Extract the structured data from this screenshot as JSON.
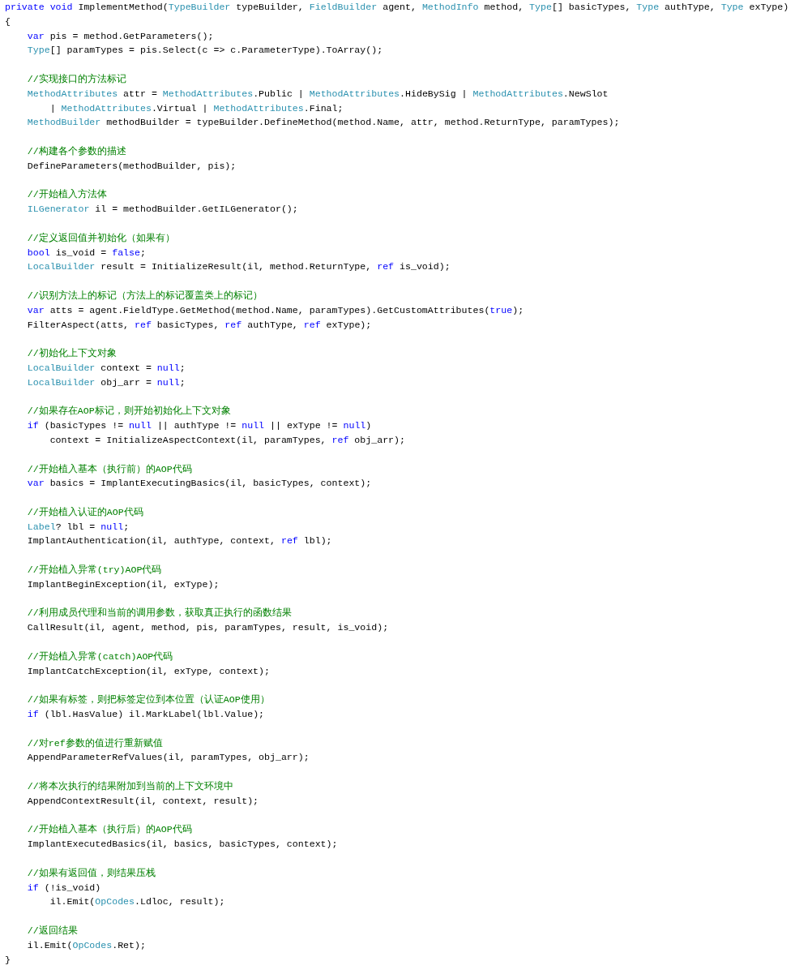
{
  "code_lines": [
    {
      "kind": "code",
      "tokens": [
        {
          "kind": "keyword",
          "text": "private void"
        },
        {
          "kind": "plain",
          "text": " ImplementMethod("
        },
        {
          "kind": "type",
          "text": "TypeBuilder"
        },
        {
          "kind": "plain",
          "text": " typeBuilder, "
        },
        {
          "kind": "type",
          "text": "FieldBuilder"
        },
        {
          "kind": "plain",
          "text": " agent, "
        },
        {
          "kind": "type",
          "text": "MethodInfo"
        },
        {
          "kind": "plain",
          "text": " method, "
        },
        {
          "kind": "type",
          "text": "Type"
        },
        {
          "kind": "plain",
          "text": "[] basicTypes, "
        },
        {
          "kind": "type",
          "text": "Type"
        },
        {
          "kind": "plain",
          "text": " authType, "
        },
        {
          "kind": "type",
          "text": "Type"
        },
        {
          "kind": "plain",
          "text": " exType)"
        }
      ]
    },
    {
      "kind": "code",
      "tokens": [
        {
          "kind": "plain",
          "text": "{"
        }
      ],
      "children": [
        {
          "kind": "code",
          "tokens": [
            {
              "kind": "keyword",
              "text": "var"
            },
            {
              "kind": "plain",
              "text": " pis = method.GetParameters();"
            }
          ]
        },
        {
          "kind": "code",
          "tokens": [
            {
              "kind": "type",
              "text": "Type"
            },
            {
              "kind": "plain",
              "text": "[] paramTypes = pis.Select(c => c.ParameterType).ToArray();"
            }
          ]
        },
        {
          "kind": "blank"
        },
        {
          "kind": "code",
          "tokens": [
            {
              "kind": "comment",
              "text": "//实现接口的方法标记"
            }
          ]
        },
        {
          "kind": "code",
          "tokens": [
            {
              "kind": "type",
              "text": "MethodAttributes"
            },
            {
              "kind": "plain",
              "text": " attr = "
            },
            {
              "kind": "type",
              "text": "MethodAttributes"
            },
            {
              "kind": "plain",
              "text": ".Public | "
            },
            {
              "kind": "type",
              "text": "MethodAttributes"
            },
            {
              "kind": "plain",
              "text": ".HideBySig | "
            },
            {
              "kind": "type",
              "text": "MethodAttributes"
            },
            {
              "kind": "plain",
              "text": ".NewSlot"
            }
          ],
          "children": [
            {
              "kind": "code",
              "tokens": [
                {
                  "kind": "plain",
                  "text": "| "
                },
                {
                  "kind": "type",
                  "text": "MethodAttributes"
                },
                {
                  "kind": "plain",
                  "text": ".Virtual | "
                },
                {
                  "kind": "type",
                  "text": "MethodAttributes"
                },
                {
                  "kind": "plain",
                  "text": ".Final;"
                }
              ]
            }
          ]
        },
        {
          "kind": "code",
          "tokens": [
            {
              "kind": "type",
              "text": "MethodBuilder"
            },
            {
              "kind": "plain",
              "text": " methodBuilder = typeBuilder.DefineMethod(method.Name, attr, method.ReturnType, paramTypes);"
            }
          ]
        },
        {
          "kind": "blank"
        },
        {
          "kind": "code",
          "tokens": [
            {
              "kind": "comment",
              "text": "//构建各个参数的描述"
            }
          ]
        },
        {
          "kind": "code",
          "tokens": [
            {
              "kind": "plain",
              "text": "DefineParameters(methodBuilder, pis);"
            }
          ]
        },
        {
          "kind": "blank"
        },
        {
          "kind": "code",
          "tokens": [
            {
              "kind": "comment",
              "text": "//开始植入方法体"
            }
          ]
        },
        {
          "kind": "code",
          "tokens": [
            {
              "kind": "type",
              "text": "ILGenerator"
            },
            {
              "kind": "plain",
              "text": " il = methodBuilder.GetILGenerator();"
            }
          ]
        },
        {
          "kind": "blank"
        },
        {
          "kind": "code",
          "tokens": [
            {
              "kind": "comment",
              "text": "//定义返回值并初始化（如果有）"
            }
          ]
        },
        {
          "kind": "code",
          "tokens": [
            {
              "kind": "keyword",
              "text": "bool"
            },
            {
              "kind": "plain",
              "text": " is_void = "
            },
            {
              "kind": "keyword",
              "text": "false"
            },
            {
              "kind": "plain",
              "text": ";"
            }
          ]
        },
        {
          "kind": "code",
          "tokens": [
            {
              "kind": "type",
              "text": "LocalBuilder"
            },
            {
              "kind": "plain",
              "text": " result = InitializeResult(il, method.ReturnType, "
            },
            {
              "kind": "keyword",
              "text": "ref"
            },
            {
              "kind": "plain",
              "text": " is_void);"
            }
          ]
        },
        {
          "kind": "blank"
        },
        {
          "kind": "code",
          "tokens": [
            {
              "kind": "comment",
              "text": "//识别方法上的标记（方法上的标记覆盖类上的标记）"
            }
          ]
        },
        {
          "kind": "code",
          "tokens": [
            {
              "kind": "keyword",
              "text": "var"
            },
            {
              "kind": "plain",
              "text": " atts = agent.FieldType.GetMethod(method.Name, paramTypes).GetCustomAttributes("
            },
            {
              "kind": "keyword",
              "text": "true"
            },
            {
              "kind": "plain",
              "text": ");"
            }
          ]
        },
        {
          "kind": "code",
          "tokens": [
            {
              "kind": "plain",
              "text": "FilterAspect(atts, "
            },
            {
              "kind": "keyword",
              "text": "ref"
            },
            {
              "kind": "plain",
              "text": " basicTypes, "
            },
            {
              "kind": "keyword",
              "text": "ref"
            },
            {
              "kind": "plain",
              "text": " authType, "
            },
            {
              "kind": "keyword",
              "text": "ref"
            },
            {
              "kind": "plain",
              "text": " exType);"
            }
          ]
        },
        {
          "kind": "blank"
        },
        {
          "kind": "code",
          "tokens": [
            {
              "kind": "comment",
              "text": "//初始化上下文对象"
            }
          ]
        },
        {
          "kind": "code",
          "tokens": [
            {
              "kind": "type",
              "text": "LocalBuilder"
            },
            {
              "kind": "plain",
              "text": " context = "
            },
            {
              "kind": "keyword",
              "text": "null"
            },
            {
              "kind": "plain",
              "text": ";"
            }
          ]
        },
        {
          "kind": "code",
          "tokens": [
            {
              "kind": "type",
              "text": "LocalBuilder"
            },
            {
              "kind": "plain",
              "text": " obj_arr = "
            },
            {
              "kind": "keyword",
              "text": "null"
            },
            {
              "kind": "plain",
              "text": ";"
            }
          ]
        },
        {
          "kind": "blank"
        },
        {
          "kind": "code",
          "tokens": [
            {
              "kind": "comment",
              "text": "//如果存在AOP标记，则开始初始化上下文对象"
            }
          ]
        },
        {
          "kind": "code",
          "tokens": [
            {
              "kind": "keyword",
              "text": "if"
            },
            {
              "kind": "plain",
              "text": " (basicTypes != "
            },
            {
              "kind": "keyword",
              "text": "null"
            },
            {
              "kind": "plain",
              "text": " || authType != "
            },
            {
              "kind": "keyword",
              "text": "null"
            },
            {
              "kind": "plain",
              "text": " || exType != "
            },
            {
              "kind": "keyword",
              "text": "null"
            },
            {
              "kind": "plain",
              "text": ")"
            }
          ],
          "children": [
            {
              "kind": "code",
              "tokens": [
                {
                  "kind": "plain",
                  "text": "context = InitializeAspectContext(il, paramTypes, "
                },
                {
                  "kind": "keyword",
                  "text": "ref"
                },
                {
                  "kind": "plain",
                  "text": " obj_arr);"
                }
              ]
            }
          ]
        },
        {
          "kind": "blank"
        },
        {
          "kind": "code",
          "tokens": [
            {
              "kind": "comment",
              "text": "//开始植入基本（执行前）的AOP代码"
            }
          ]
        },
        {
          "kind": "code",
          "tokens": [
            {
              "kind": "keyword",
              "text": "var"
            },
            {
              "kind": "plain",
              "text": " basics = ImplantExecutingBasics(il, basicTypes, context);"
            }
          ]
        },
        {
          "kind": "blank"
        },
        {
          "kind": "code",
          "tokens": [
            {
              "kind": "comment",
              "text": "//开始植入认证的AOP代码"
            }
          ]
        },
        {
          "kind": "code",
          "tokens": [
            {
              "kind": "type",
              "text": "Label"
            },
            {
              "kind": "plain",
              "text": "? lbl = "
            },
            {
              "kind": "keyword",
              "text": "null"
            },
            {
              "kind": "plain",
              "text": ";"
            }
          ]
        },
        {
          "kind": "code",
          "tokens": [
            {
              "kind": "plain",
              "text": "ImplantAuthentication(il, authType, context, "
            },
            {
              "kind": "keyword",
              "text": "ref"
            },
            {
              "kind": "plain",
              "text": " lbl);"
            }
          ]
        },
        {
          "kind": "blank"
        },
        {
          "kind": "code",
          "tokens": [
            {
              "kind": "comment",
              "text": "//开始植入异常(try)AOP代码"
            }
          ]
        },
        {
          "kind": "code",
          "tokens": [
            {
              "kind": "plain",
              "text": "ImplantBeginException(il, exType);"
            }
          ]
        },
        {
          "kind": "blank"
        },
        {
          "kind": "code",
          "tokens": [
            {
              "kind": "comment",
              "text": "//利用成员代理和当前的调用参数，获取真正执行的函数结果"
            }
          ]
        },
        {
          "kind": "code",
          "tokens": [
            {
              "kind": "plain",
              "text": "CallResult(il, agent, method, pis, paramTypes, result, is_void);"
            }
          ]
        },
        {
          "kind": "blank"
        },
        {
          "kind": "code",
          "tokens": [
            {
              "kind": "comment",
              "text": "//开始植入异常(catch)AOP代码"
            }
          ]
        },
        {
          "kind": "code",
          "tokens": [
            {
              "kind": "plain",
              "text": "ImplantCatchException(il, exType, context);"
            }
          ]
        },
        {
          "kind": "blank"
        },
        {
          "kind": "code",
          "tokens": [
            {
              "kind": "comment",
              "text": "//如果有标签，则把标签定位到本位置（认证AOP使用）"
            }
          ]
        },
        {
          "kind": "code",
          "tokens": [
            {
              "kind": "keyword",
              "text": "if"
            },
            {
              "kind": "plain",
              "text": " (lbl.HasValue) il.MarkLabel(lbl.Value);"
            }
          ]
        },
        {
          "kind": "blank"
        },
        {
          "kind": "code",
          "tokens": [
            {
              "kind": "comment",
              "text": "//对ref参数的值进行重新赋值"
            }
          ]
        },
        {
          "kind": "code",
          "tokens": [
            {
              "kind": "plain",
              "text": "AppendParameterRefValues(il, paramTypes, obj_arr);"
            }
          ]
        },
        {
          "kind": "blank"
        },
        {
          "kind": "code",
          "tokens": [
            {
              "kind": "comment",
              "text": "//将本次执行的结果附加到当前的上下文环境中"
            }
          ]
        },
        {
          "kind": "code",
          "tokens": [
            {
              "kind": "plain",
              "text": "AppendContextResult(il, context, result);"
            }
          ]
        },
        {
          "kind": "blank"
        },
        {
          "kind": "code",
          "tokens": [
            {
              "kind": "comment",
              "text": "//开始植入基本（执行后）的AOP代码"
            }
          ]
        },
        {
          "kind": "code",
          "tokens": [
            {
              "kind": "plain",
              "text": "ImplantExecutedBasics(il, basics, basicTypes, context);"
            }
          ]
        },
        {
          "kind": "blank"
        },
        {
          "kind": "code",
          "tokens": [
            {
              "kind": "comment",
              "text": "//如果有返回值，则结果压栈"
            }
          ]
        },
        {
          "kind": "code",
          "tokens": [
            {
              "kind": "keyword",
              "text": "if"
            },
            {
              "kind": "plain",
              "text": " (!is_void)"
            }
          ],
          "children": [
            {
              "kind": "code",
              "tokens": [
                {
                  "kind": "plain",
                  "text": "il.Emit("
                },
                {
                  "kind": "type",
                  "text": "OpCodes"
                },
                {
                  "kind": "plain",
                  "text": ".Ldloc, result);"
                }
              ]
            }
          ]
        },
        {
          "kind": "blank"
        },
        {
          "kind": "code",
          "tokens": [
            {
              "kind": "comment",
              "text": "//返回结果"
            }
          ]
        },
        {
          "kind": "code",
          "tokens": [
            {
              "kind": "plain",
              "text": "il.Emit("
            },
            {
              "kind": "type",
              "text": "OpCodes"
            },
            {
              "kind": "plain",
              "text": ".Ret);"
            }
          ]
        }
      ]
    },
    {
      "kind": "code",
      "tokens": [
        {
          "kind": "plain",
          "text": "}"
        }
      ]
    }
  ]
}
